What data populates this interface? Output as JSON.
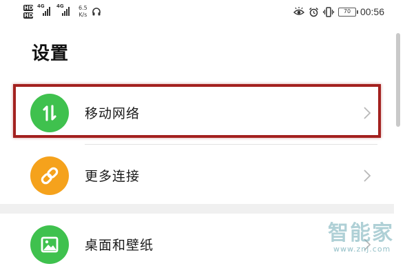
{
  "status_bar": {
    "sim1_badge": "HD",
    "sim2_badge": "HD",
    "sim1_network": "4G",
    "sim2_network": "4G",
    "net_speed_value": "6.5",
    "net_speed_unit": "K/s",
    "battery_level": "70",
    "time": "00:56"
  },
  "header": {
    "title": "设置"
  },
  "settings": {
    "items": [
      {
        "label": "移动网络",
        "icon": "swap-arrows-icon",
        "icon_color": "#3fc14e"
      },
      {
        "label": "更多连接",
        "icon": "link-icon",
        "icon_color": "#f5a21c"
      },
      {
        "label": "桌面和壁纸",
        "icon": "image-icon",
        "icon_color": "#3fc14e"
      }
    ]
  },
  "colors": {
    "highlight_border": "#a3211f",
    "chevron": "#b8b8b8"
  },
  "watermark": {
    "text": "智能家",
    "url": "www.znj.com"
  }
}
